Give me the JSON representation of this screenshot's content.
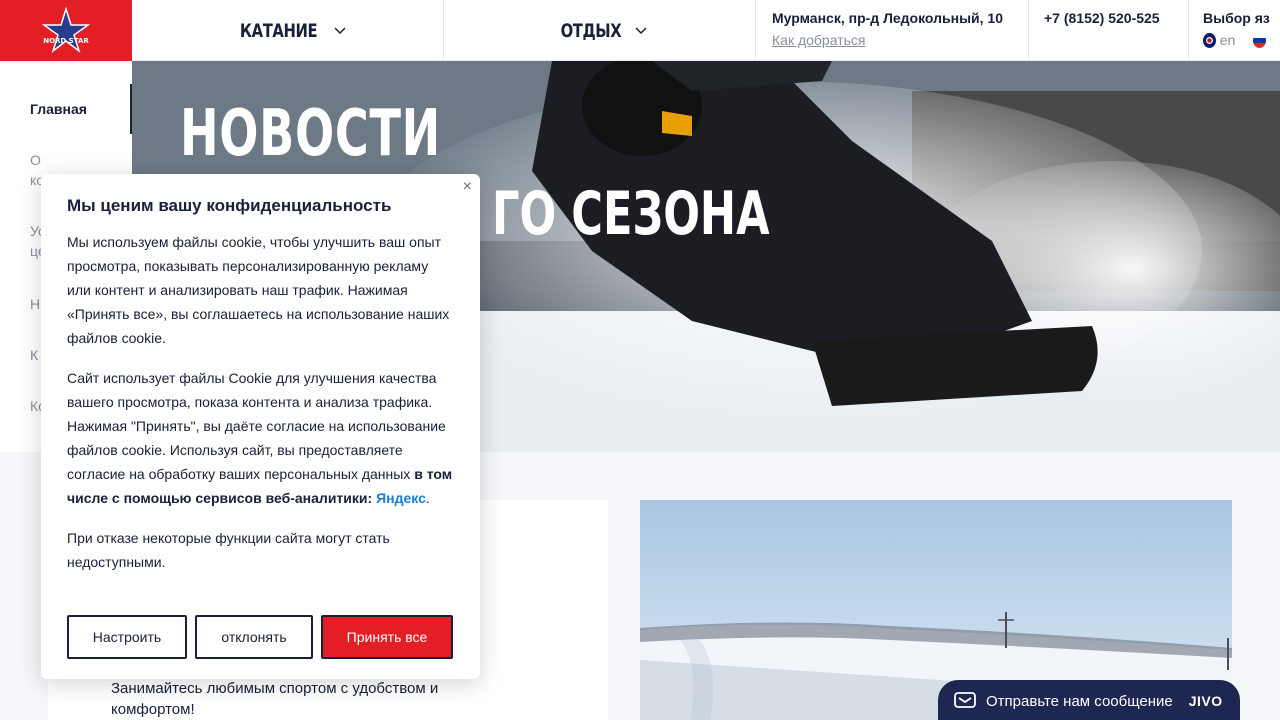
{
  "header": {
    "logo_text": "NORD STAR",
    "nav": [
      {
        "label": "КАТАНИЕ"
      },
      {
        "label": "ОТДЫХ"
      }
    ],
    "address": "Мурманск, пр-д Ледокольный, 10",
    "directions_link": "Как добраться",
    "phone": "+7 (8152) 520-525",
    "language_title": "Выбор яз",
    "language_current": "en"
  },
  "sidebar": {
    "items": [
      {
        "label": "Главная"
      },
      {
        "label": "О\nко"
      },
      {
        "label": "Ус\nце"
      },
      {
        "label": "Н"
      },
      {
        "label": "К"
      },
      {
        "label": "Ко"
      }
    ]
  },
  "hero": {
    "title": "НОВОСТИ",
    "subtitle": "ГО СЕЗОНА"
  },
  "content": {
    "card_text": "Занимайтесь любимым спортом с удобством и комфортом!"
  },
  "cookie": {
    "title": "Мы ценим вашу конфиденциальность",
    "close": "×",
    "p1": "Мы используем файлы cookie, чтобы улучшить ваш опыт просмотра, показывать персонализированную рекламу или контент и анализировать наш трафик. Нажимая «Принять все», вы соглашаетесь на использование наших файлов cookie.",
    "p2_start": "Сайт использует файлы Cookie для улучшения качества вашего просмотра, показа контента и анализа трафика. Нажимая \"Принять\", вы даёте согласие на использование файлов cookie. Используя сайт, вы предоставляете согласие на обработку ваших персональных данных ",
    "p2_bold": "в том числе с помощью сервисов веб-аналитики:",
    "p2_link": "Яндекс",
    "p2_end": ".",
    "p3": "При отказе некоторые функции сайта могут стать недоступными.",
    "btn_settings": "Настроить",
    "btn_reject": "отклонять",
    "btn_accept": "Принять все"
  },
  "jivo": {
    "message": "Отправьте нам сообщение",
    "brand": "JIVO"
  },
  "colors": {
    "brand_red": "#e31e24",
    "navy": "#1a1f3a",
    "jivo_bg": "#1d2752",
    "link_blue": "#1d7ed8"
  }
}
